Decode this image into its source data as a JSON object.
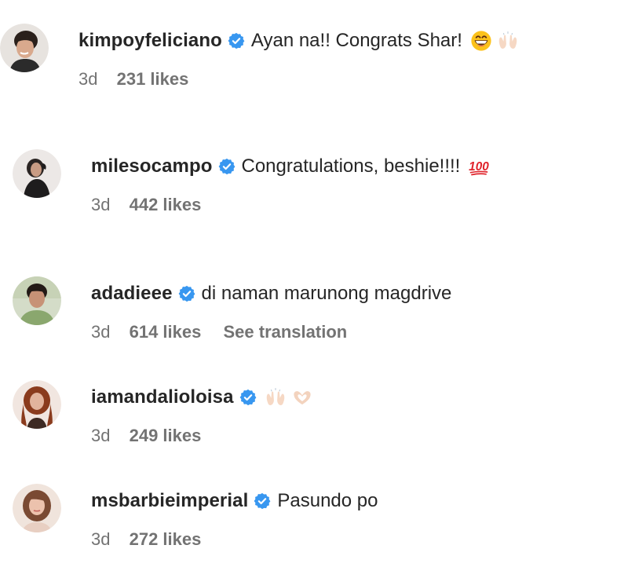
{
  "comments": [
    {
      "username": "kimpoyfeliciano",
      "text": "Ayan na!! Congrats Shar!",
      "emojis": [
        "grinning-face-emoji",
        "raising-hands-emoji"
      ],
      "time": "3d",
      "likes": "231 likes",
      "avatar": "kimpoy-avatar"
    },
    {
      "username": "milesocampo",
      "text": "Congratulations, beshie!!!!",
      "emojis": [
        "hundred-points-emoji"
      ],
      "time": "3d",
      "likes": "442 likes",
      "avatar": "miles-avatar"
    },
    {
      "username": "adadieee",
      "text": "di naman marunong magdrive",
      "emojis": [],
      "time": "3d",
      "likes": "614 likes",
      "see_translation": "See translation",
      "avatar": "adadieee-avatar"
    },
    {
      "username": "iamandalioloisa",
      "text": "",
      "emojis": [
        "raising-hands-emoji",
        "heart-hands-emoji"
      ],
      "time": "3d",
      "likes": "249 likes",
      "avatar": "andi-avatar"
    },
    {
      "username": "msbarbieimperial",
      "text": "Pasundo po",
      "emojis": [],
      "time": "3d",
      "likes": "272 likes",
      "avatar": "barbie-avatar"
    }
  ],
  "colors": {
    "verified": "#3897f0",
    "username": "#262626",
    "meta": "#737373"
  }
}
